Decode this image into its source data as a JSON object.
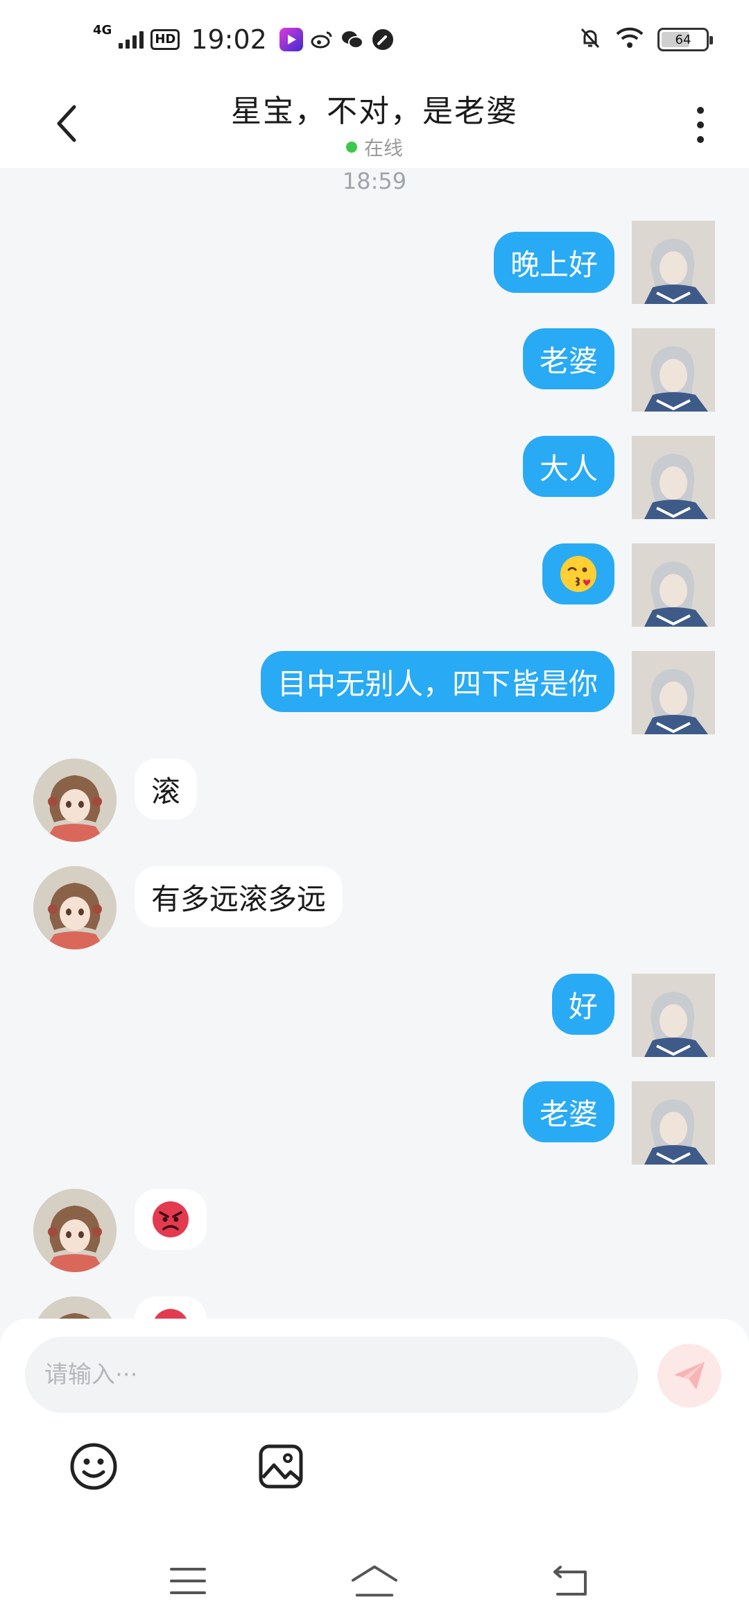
{
  "status_bar": {
    "network": "4G",
    "hd_badge": "HD",
    "time": "19:02",
    "battery": "64",
    "battery_level": 0.64,
    "icons": [
      "signal-icon",
      "hd-icon",
      "video-app-icon",
      "weibo-icon",
      "wechat-icon",
      "compass-app-icon",
      "mute-icon",
      "wifi-icon",
      "battery-icon"
    ]
  },
  "header": {
    "title": "星宝，不对，是老婆",
    "status_text": "在线",
    "status_color": "#3ac94b",
    "back_icon": "chevron-left-icon",
    "more_icon": "more-vertical-icon"
  },
  "chat": {
    "timestamp": "18:59",
    "messages": [
      {
        "sender": "me",
        "type": "text",
        "text": "晚上好"
      },
      {
        "sender": "me",
        "type": "text",
        "text": "老婆"
      },
      {
        "sender": "me",
        "type": "text",
        "text": "大人"
      },
      {
        "sender": "me",
        "type": "emoji",
        "emoji": "kissing-heart-emoji"
      },
      {
        "sender": "me",
        "type": "text",
        "text": "目中无别人，四下皆是你"
      },
      {
        "sender": "her",
        "type": "text",
        "text": "滚"
      },
      {
        "sender": "her",
        "type": "text",
        "text": "有多远滚多远"
      },
      {
        "sender": "me",
        "type": "text",
        "text": "好"
      },
      {
        "sender": "me",
        "type": "text",
        "text": "老婆"
      },
      {
        "sender": "her",
        "type": "emoji",
        "emoji": "angry-face-emoji"
      },
      {
        "sender": "her",
        "type": "emoji",
        "emoji": "angry-face-emoji"
      }
    ]
  },
  "input": {
    "placeholder": "请输入···",
    "value": "",
    "send_icon": "send-icon",
    "tools": [
      "emoji-icon",
      "image-icon"
    ]
  },
  "colors": {
    "my_bubble": "#29aaf4",
    "her_bubble": "#ffffff",
    "chat_background": "#f4f6f8",
    "send_button": "#fde8e8"
  },
  "nav_bar": {
    "buttons": [
      "menu-icon",
      "home-icon",
      "back-icon"
    ]
  }
}
